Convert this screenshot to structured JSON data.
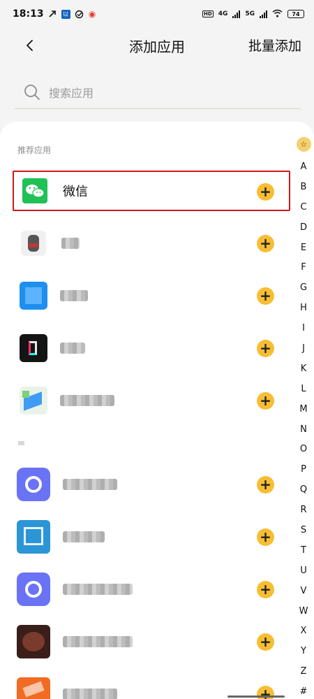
{
  "status_bar": {
    "time": "18:13",
    "left_icons": [
      "signal-arrow-icon",
      "notification-app-icon",
      "check-circle-icon",
      "weibo-icon"
    ],
    "hd_label": "HD",
    "net_4g": "4G",
    "net_5g": "5G",
    "battery": "74"
  },
  "header": {
    "title": "添加应用",
    "batch_add": "批量添加"
  },
  "search": {
    "placeholder": "搜索应用"
  },
  "section": {
    "title": "推荐应用"
  },
  "apps": [
    {
      "name": "微信",
      "icon": "wechat-icon",
      "highlighted": true,
      "color": "#20c157"
    },
    {
      "name": "QQ",
      "icon": "qq-icon",
      "blurred": true,
      "color": "#b63b3b"
    },
    {
      "name": "TTT",
      "icon": "blue-app-icon",
      "blurred": true,
      "color": "#1e8ff0"
    },
    {
      "name": "抖音",
      "icon": "douyin-icon",
      "blurred": true,
      "color": "#141414"
    },
    {
      "name": "高德地图",
      "icon": "map-app-icon",
      "blurred": true,
      "color": "#3f9cf4"
    },
    {
      "name": "阿里云盘",
      "icon": "cloud-disk-icon",
      "blurred": true,
      "color": "#6a73f5"
    },
    {
      "name": "阿里TV",
      "icon": "tv-app-icon",
      "blurred": true,
      "color": "#2b95d6"
    },
    {
      "name": "阿里云盘...",
      "icon": "cloud-disk-icon-2",
      "blurred": true,
      "color": "#6a73f5"
    },
    {
      "name": "电视助手...",
      "icon": "dark-app-icon",
      "blurred": true,
      "color": "#3a1e1a"
    },
    {
      "name": "阿里巴巴",
      "icon": "orange-app-icon",
      "blurred": true,
      "color": "#f26b22"
    }
  ],
  "index_bar": {
    "star": "☆",
    "letters": [
      "A",
      "B",
      "C",
      "D",
      "E",
      "F",
      "G",
      "H",
      "I",
      "J",
      "K",
      "L",
      "M",
      "N",
      "O",
      "P",
      "Q",
      "R",
      "S",
      "T",
      "U",
      "V",
      "W",
      "X",
      "Y",
      "Z",
      "#"
    ]
  },
  "colors": {
    "accent": "#f7be33",
    "highlight_border": "#d0161b",
    "background": "#f4f4f4"
  }
}
